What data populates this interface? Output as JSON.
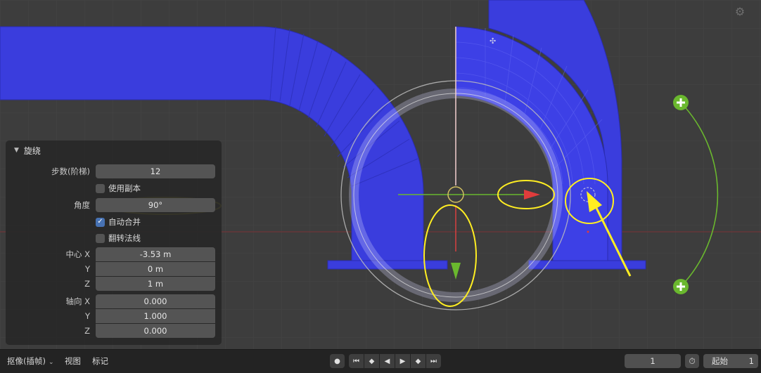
{
  "panel": {
    "title": "旋绕",
    "steps": {
      "label": "步数(阶梯)",
      "value": "12"
    },
    "use_duplicates": {
      "label": "使用副本",
      "checked": false
    },
    "angle": {
      "label": "角度",
      "value": "90°"
    },
    "auto_merge": {
      "label": "自动合并",
      "checked": true
    },
    "flip_normals": {
      "label": "翻转法线",
      "checked": false
    },
    "center": {
      "label_x": "中心 X",
      "label_y": "Y",
      "label_z": "Z",
      "x": "-3.53 m",
      "y": "0 m",
      "z": "1 m"
    },
    "axis": {
      "label_x": "轴向 X",
      "label_y": "Y",
      "label_z": "Z",
      "x": "0.000",
      "y": "1.000",
      "z": "0.000"
    }
  },
  "timeline": {
    "keying_menu": "抠像(插帧)",
    "view_menu": "视图",
    "marker_menu": "标记",
    "current_frame": "1",
    "start_label": "起始",
    "start_value": "1"
  },
  "icons": {
    "record": "record-icon",
    "jump_start": "jump-to-start-icon",
    "prev_keyframe": "prev-keyframe-icon",
    "play_reverse": "play-reverse-icon",
    "play": "play-icon",
    "next_keyframe": "next-keyframe-icon",
    "jump_end": "jump-to-end-icon",
    "stopwatch": "stopwatch-icon",
    "view_gizmo": "gear-icon"
  },
  "colors": {
    "mesh": "#3a3ddd",
    "mesh_dark": "#2b2ec4",
    "gizmo_red": "#e03c3c",
    "gizmo_green": "#6ab82e",
    "annotation": "#ffee22",
    "checkbox_on": "#4772b3",
    "viewport_bg": "#3d3d3d"
  }
}
